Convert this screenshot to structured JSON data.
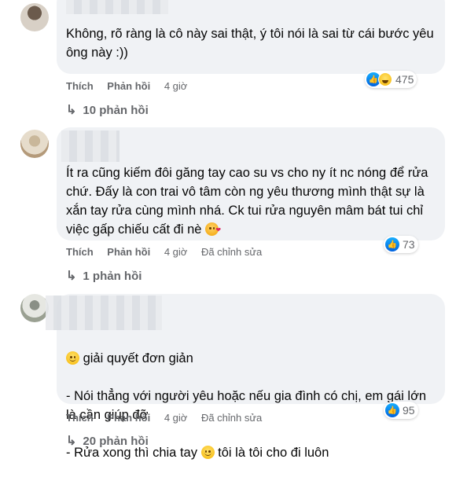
{
  "comments": [
    {
      "text": "Không, rõ ràng là cô này sai thật, ý tôi nói là sai từ cái bước yêu ông này :))",
      "like_label": "Thích",
      "reply_label": "Phản hồi",
      "time": "4 giờ",
      "edited": "",
      "reactions": [
        "like-icon",
        "haha-icon"
      ],
      "reaction_count": "475",
      "replies_label": "10 phản hồi"
    },
    {
      "text": "Ít ra cũng kiếm đôi găng tay cao su vs cho ny ít nc nóng để rửa chứ. Đấy là con trai vô tâm còn ng yêu thương mình thật sự là xắn tay rửa cùng mình nhá. Ck tui rửa nguyên mâm bát tui chỉ việc gấp chiếu cất đi nè",
      "like_label": "Thích",
      "reply_label": "Phản hồi",
      "time": "4 giờ",
      "edited": "Đã chỉnh sửa",
      "reactions": [
        "like-icon"
      ],
      "reaction_count": "73",
      "replies_label": "1 phản hồi"
    },
    {
      "line1": "giải quyết đơn giản",
      "line2": "- Nói thẳng với người yêu hoặc nếu gia đình có chị, em gái lớn là cần giúp đỡ",
      "line3a": "- Rửa xong thì chia tay",
      "line3b": "tôi là tôi cho đi luôn",
      "like_label": "Thích",
      "reply_label": "Phản hồi",
      "time": "4 giờ",
      "edited": "Đã chỉnh sửa",
      "reactions": [
        "like-icon"
      ],
      "reaction_count": "95",
      "replies_label": "20 phản hồi"
    }
  ],
  "colors": {
    "bubble": "#f0f2f5",
    "meta_text": "#65676b",
    "like_blue": "#0062df"
  }
}
